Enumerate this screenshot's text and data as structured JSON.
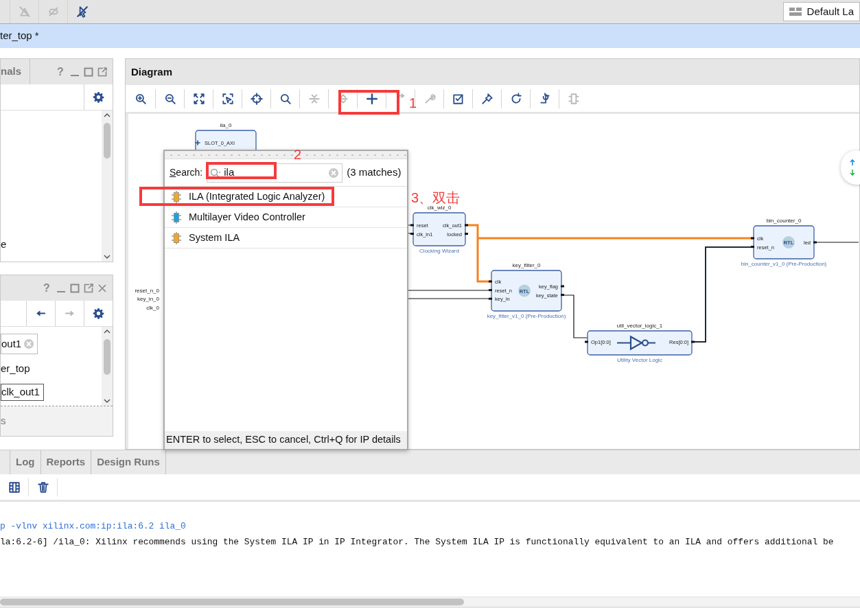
{
  "top_toolbar": {
    "tools": [
      {
        "kind": "slashed-net",
        "disabled": true
      },
      {
        "kind": "slashed-link",
        "disabled": true
      },
      {
        "kind": "slashed-cursor",
        "disabled": false
      }
    ],
    "layout_selector": "Default La"
  },
  "document_tab": {
    "title": "ter_top *"
  },
  "left_panel_top": {
    "tab": "nals",
    "help": "?",
    "rows": [
      "e"
    ]
  },
  "left_panel_bottom": {
    "help": "?",
    "nav": [
      {
        "kind": "back",
        "disabled": false
      },
      {
        "kind": "forward",
        "disabled": true
      }
    ],
    "items": [
      {
        "kind": "clear-field",
        "value": "out1"
      },
      {
        "kind": "text",
        "text": "er_top"
      },
      {
        "kind": "field",
        "value": "clk_out1"
      }
    ],
    "footer": "s"
  },
  "diagram": {
    "title": "Diagram",
    "tools": [
      {
        "kind": "zoom-in",
        "disabled": false
      },
      {
        "kind": "zoom-out",
        "disabled": false
      },
      {
        "kind": "fit",
        "disabled": false
      },
      {
        "kind": "select-area",
        "disabled": false
      },
      {
        "kind": "crosshair",
        "disabled": false
      },
      {
        "kind": "search",
        "disabled": false
      },
      {
        "kind": "collapse",
        "disabled": true
      },
      {
        "kind": "expand",
        "disabled": true
      },
      {
        "kind": "add",
        "disabled": false
      },
      {
        "kind": "route",
        "disabled": true
      },
      {
        "kind": "wrench",
        "disabled": true
      },
      {
        "kind": "validate",
        "disabled": false
      },
      {
        "kind": "pin",
        "disabled": false
      },
      {
        "kind": "refresh",
        "disabled": false
      },
      {
        "kind": "regenerate",
        "disabled": false
      },
      {
        "kind": "chip",
        "disabled": true
      }
    ],
    "blocks": [
      {
        "kind": "ila",
        "name": "ila_0",
        "left_ports": [
          "SLOT_0_AXI"
        ]
      },
      {
        "kind": "ip",
        "name": "clk_wiz_0",
        "left_ports": [
          "reset",
          "clk_in1"
        ],
        "right_ports": [
          "clk_out1",
          "locked"
        ],
        "subtitle": "Clocking Wizard"
      },
      {
        "kind": "rtl",
        "name": "key_filter_0",
        "left_ports": [
          "clk",
          "reset_n",
          "key_in"
        ],
        "right_ports": [
          "key_flag",
          "key_state"
        ],
        "badge": "RTL",
        "subtitle": "key_filter_v1_0 (Pre-Production)"
      },
      {
        "kind": "inverter",
        "name": "util_vector_logic_1",
        "left_ports": [
          "Op1[0:0]"
        ],
        "right_ports": [
          "Res[0:0]"
        ],
        "subtitle": "Utility Vector Logic"
      },
      {
        "kind": "rtl",
        "name": "bin_counter_0",
        "left_ports": [
          "clk",
          "reset_n"
        ],
        "right_ports": [
          "led"
        ],
        "badge": "RTL",
        "subtitle": "bin_counter_v1_0 (Pre-Production)"
      }
    ],
    "external_ports": [
      "reset_n_0",
      "key_in_0",
      "clk_0"
    ],
    "add_ip_popup": {
      "search_label": "Search:",
      "search_value": "ila",
      "match_count": "(3 matches)",
      "items": [
        {
          "label": "ILA (Integrated Logic Analyzer)",
          "color": "#f5a623"
        },
        {
          "label": "Multilayer Video Controller",
          "color": "#1ba1e2"
        },
        {
          "label": "System ILA",
          "color": "#f5a623"
        }
      ],
      "hint": "ENTER to select, ESC to cancel, Ctrl+Q for IP details"
    }
  },
  "annotations": [
    {
      "text": "1"
    },
    {
      "text": "2"
    },
    {
      "text": "3、双击"
    }
  ],
  "bottom_panel": {
    "tabs": [
      {
        "label": "Log",
        "selected": false
      },
      {
        "label": "Reports",
        "selected": false
      },
      {
        "label": "Design Runs",
        "selected": false
      }
    ],
    "tools": [
      {
        "kind": "columns"
      },
      {
        "kind": "trash"
      }
    ],
    "console_lines": [
      {
        "kind": "command",
        "text": "p -vlnv xilinx.com:ip:ila:6.2 ila_0"
      },
      {
        "kind": "message",
        "text": "la:6.2-6] /ila_0: Xilinx recommends using the System ILA IP in IP Integrator. The System ILA IP is functionally equivalent to an ILA and offers additional be"
      }
    ]
  }
}
